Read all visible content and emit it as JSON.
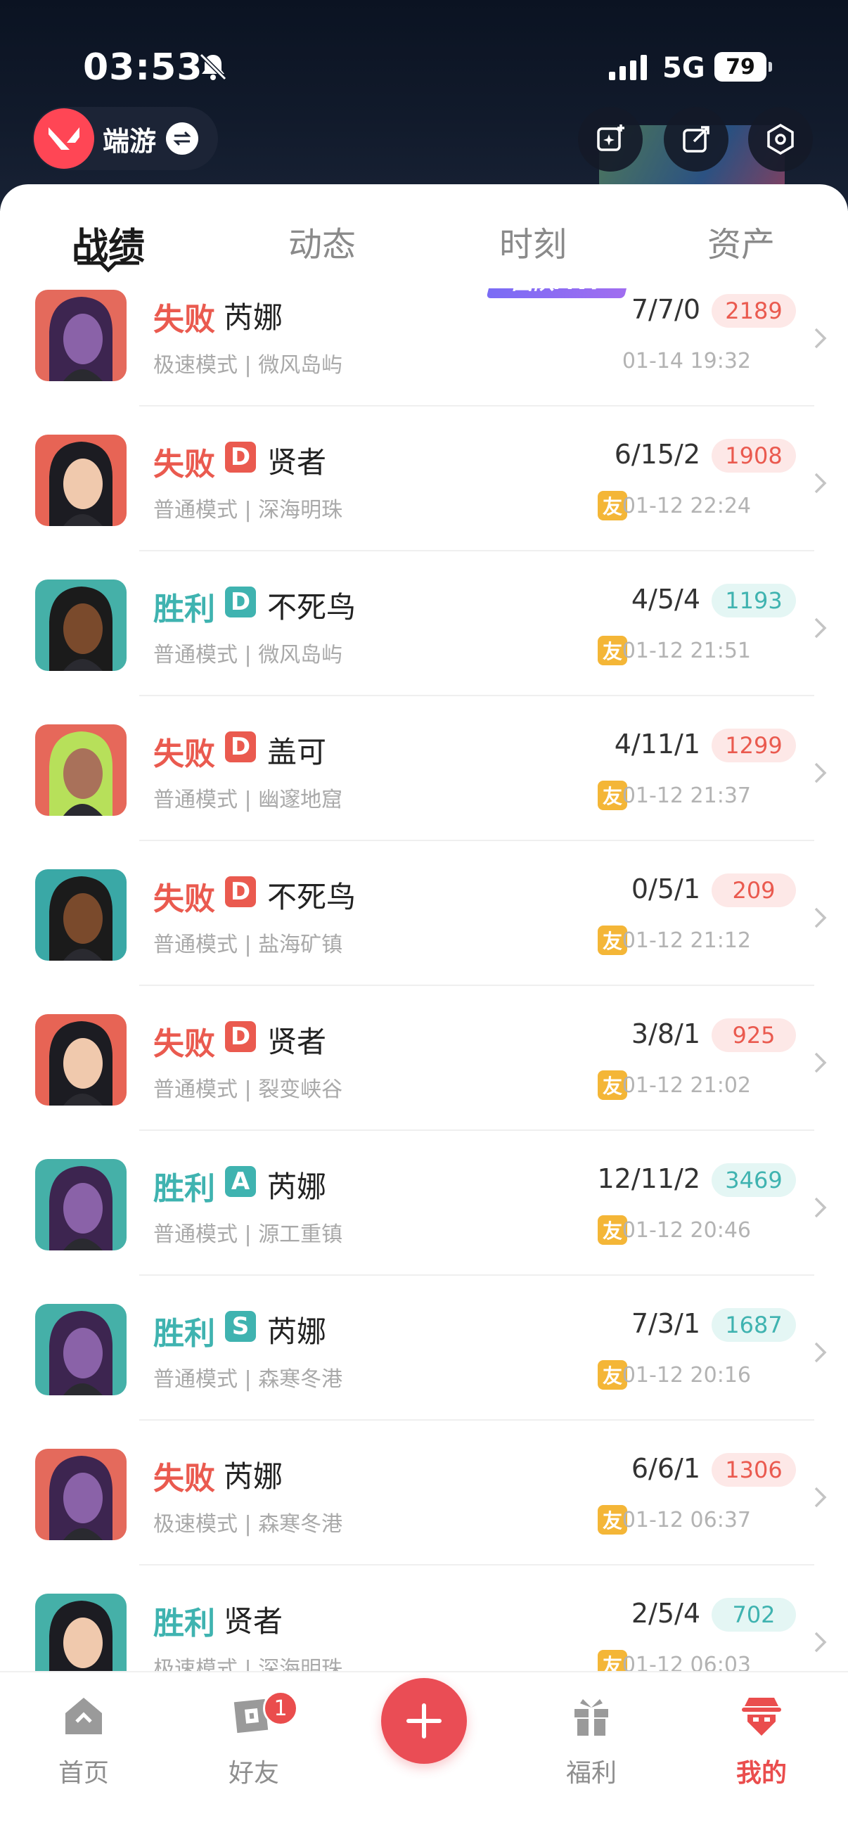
{
  "status_bar": {
    "time": "03:53",
    "network": "5G",
    "battery": "79"
  },
  "header": {
    "game_name": "端游"
  },
  "tabs": [
    {
      "label": "战绩"
    },
    {
      "label": "动态"
    },
    {
      "label": "时刻"
    },
    {
      "label": "资产"
    }
  ],
  "colors": {
    "win": "#3fb3b0",
    "lose": "#ea5a4f",
    "accent": "#ea4d55",
    "friend": "#f4b637",
    "mvp": "#7a6cf5"
  },
  "matches": [
    {
      "result": "失败",
      "outcome": "lose",
      "grade": "",
      "agent": "芮娜",
      "mode": "极速模式",
      "map": "微风岛屿",
      "kda": "7/7/0",
      "score": "2189",
      "time": "01-14 19:32",
      "friend": false,
      "mvp": "团队MVP",
      "avatar": "reyna"
    },
    {
      "result": "失败",
      "outcome": "lose",
      "grade": "D",
      "agent": "贤者",
      "mode": "普通模式",
      "map": "深海明珠",
      "kda": "6/15/2",
      "score": "1908",
      "time": "01-12 22:24",
      "friend": true,
      "friend_label": "友",
      "avatar": "sage"
    },
    {
      "result": "胜利",
      "outcome": "win",
      "grade": "D",
      "agent": "不死鸟",
      "mode": "普通模式",
      "map": "微风岛屿",
      "kda": "4/5/4",
      "score": "1193",
      "time": "01-12 21:51",
      "friend": true,
      "friend_label": "友",
      "avatar": "phoenix"
    },
    {
      "result": "失败",
      "outcome": "lose",
      "grade": "D",
      "agent": "盖可",
      "mode": "普通模式",
      "map": "幽邃地窟",
      "kda": "4/11/1",
      "score": "1299",
      "time": "01-12 21:37",
      "friend": true,
      "friend_label": "友",
      "avatar": "gekko"
    },
    {
      "result": "失败",
      "outcome": "lose",
      "grade": "D",
      "agent": "不死鸟",
      "mode": "普通模式",
      "map": "盐海矿镇",
      "kda": "0/5/1",
      "score": "209",
      "time": "01-12 21:12",
      "friend": true,
      "friend_label": "友",
      "avatar": "phoenix"
    },
    {
      "result": "失败",
      "outcome": "lose",
      "grade": "D",
      "agent": "贤者",
      "mode": "普通模式",
      "map": "裂变峡谷",
      "kda": "3/8/1",
      "score": "925",
      "time": "01-12 21:02",
      "friend": true,
      "friend_label": "友",
      "avatar": "sage"
    },
    {
      "result": "胜利",
      "outcome": "win",
      "grade": "A",
      "agent": "芮娜",
      "mode": "普通模式",
      "map": "源工重镇",
      "kda": "12/11/2",
      "score": "3469",
      "time": "01-12 20:46",
      "friend": true,
      "friend_label": "友",
      "avatar": "reyna"
    },
    {
      "result": "胜利",
      "outcome": "win",
      "grade": "S",
      "agent": "芮娜",
      "mode": "普通模式",
      "map": "森寒冬港",
      "kda": "7/3/1",
      "score": "1687",
      "time": "01-12 20:16",
      "friend": true,
      "friend_label": "友",
      "avatar": "reyna"
    },
    {
      "result": "失败",
      "outcome": "lose",
      "grade": "",
      "agent": "芮娜",
      "mode": "极速模式",
      "map": "森寒冬港",
      "kda": "6/6/1",
      "score": "1306",
      "time": "01-12 06:37",
      "friend": true,
      "friend_label": "友",
      "avatar": "reyna"
    },
    {
      "result": "胜利",
      "outcome": "win",
      "grade": "",
      "agent": "贤者",
      "mode": "极速模式",
      "map": "深海明珠",
      "kda": "2/5/4",
      "score": "702",
      "time": "01-12 06:03",
      "friend": true,
      "friend_label": "友",
      "avatar": "sage"
    }
  ],
  "bottom_nav": [
    {
      "label": "首页",
      "icon": "home-icon"
    },
    {
      "label": "好友",
      "icon": "friends-icon",
      "badge": "1"
    },
    {
      "label": "福利",
      "icon": "gift-icon"
    },
    {
      "label": "我的",
      "icon": "profile-icon"
    }
  ]
}
